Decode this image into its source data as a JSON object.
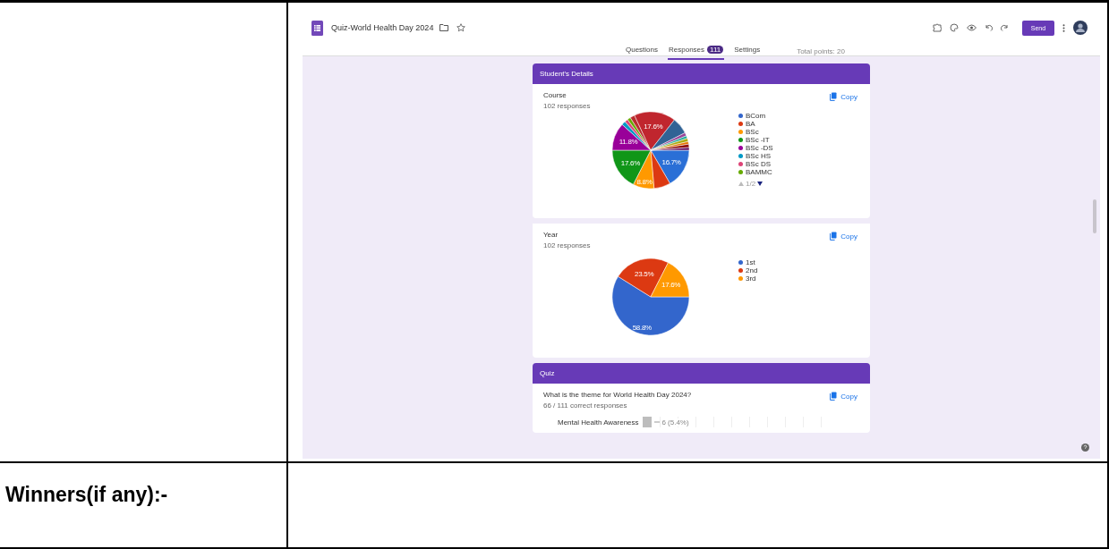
{
  "form_header": {
    "title": "Quiz-World Health Day 2024",
    "send_button": "Send",
    "tabs": [
      {
        "label": "Questions",
        "selected": false
      },
      {
        "label": "Responses",
        "selected": true,
        "badge": "111"
      },
      {
        "label": "Settings",
        "selected": false
      }
    ],
    "total_points": "Total points: 20"
  },
  "sections": [
    {
      "title": "Student's Details",
      "questions": [
        {
          "kind": "pie_picture",
          "title": "Course",
          "subtitle": "102 responses",
          "copy": "Copy",
          "slice_labels": [
            "16.7%",
            "8.8%",
            "17.6%",
            "11.8%",
            "17.6%"
          ],
          "legend": [
            {
              "label": "BCom",
              "color": "#3366cc"
            },
            {
              "label": "BA",
              "color": "#dc3912"
            },
            {
              "label": "BSc",
              "color": "#ff9900"
            },
            {
              "label": "BSc -IT",
              "color": "#109618"
            },
            {
              "label": "BSc -DS",
              "color": "#990099"
            },
            {
              "label": "BSc HS",
              "color": "#0099c6"
            },
            {
              "label": "BSc DS",
              "color": "#dd4477"
            },
            {
              "label": "BAMMC",
              "color": "#66aa00"
            }
          ],
          "pager": "1/2"
        },
        {
          "kind": "pie_picture",
          "title": "Year",
          "subtitle": "102 responses",
          "copy": "Copy",
          "slice_labels": [
            "58.8%",
            "23.5%",
            "17.6%"
          ],
          "legend": [
            {
              "label": "1st",
              "color": "#3366cc"
            },
            {
              "label": "2nd",
              "color": "#dc3912"
            },
            {
              "label": "3rd",
              "color": "#ff9900"
            }
          ]
        }
      ]
    },
    {
      "title": "Quiz",
      "questions": [
        {
          "kind": "bar",
          "title": "What is the theme for World Health Day 2024?",
          "subtitle": "66 / 111 correct responses",
          "copy": "Copy",
          "options": [
            {
              "label": "Mental Health Awareness",
              "reading": "6 (5.4%)",
              "level": 0.054
            }
          ]
        }
      ]
    }
  ],
  "winners_label": "Winners(if any):-"
}
